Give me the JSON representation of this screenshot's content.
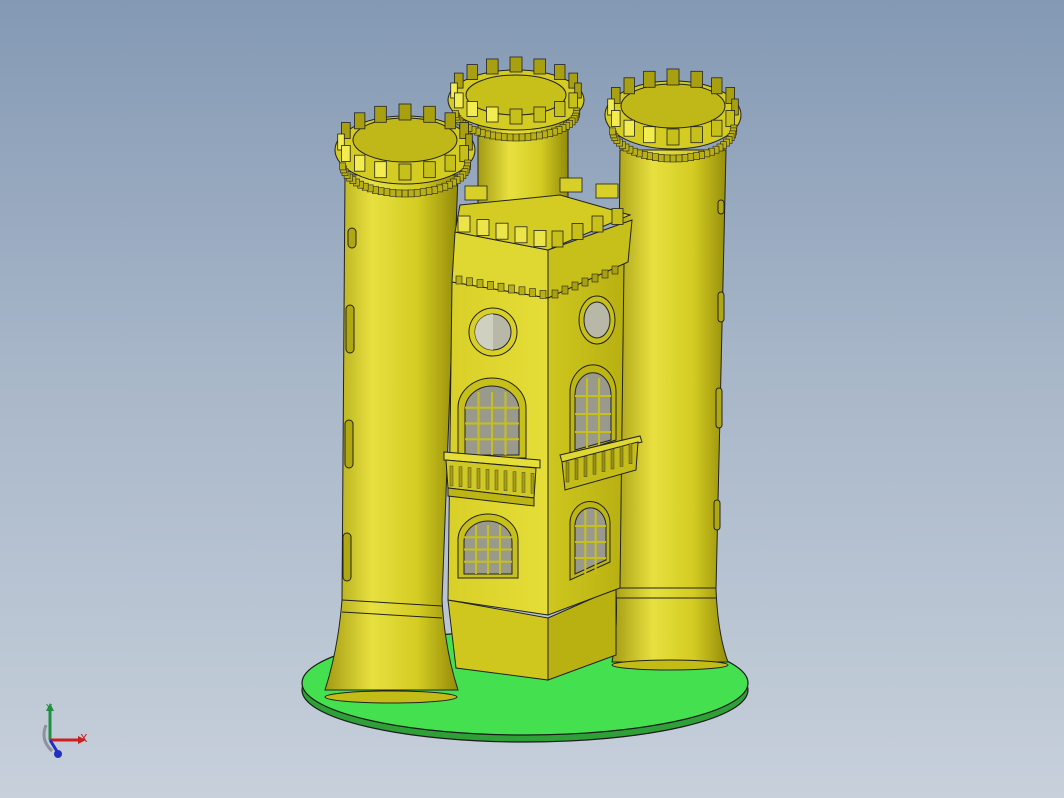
{
  "viewport": {
    "background_top": "#8499b4",
    "background_bottom": "#c7d0db"
  },
  "model": {
    "name": "castle",
    "body_color": "#d9d12a",
    "body_dark": "#a29a10",
    "body_light": "#f0ea60",
    "base_color": "#3fe04a",
    "window_glass": "#b8b8a8"
  },
  "triad": {
    "x_label": "X",
    "y_label": "Y",
    "x_color": "#cc2020",
    "y_color": "#209040",
    "z_color": "#2030c0"
  }
}
